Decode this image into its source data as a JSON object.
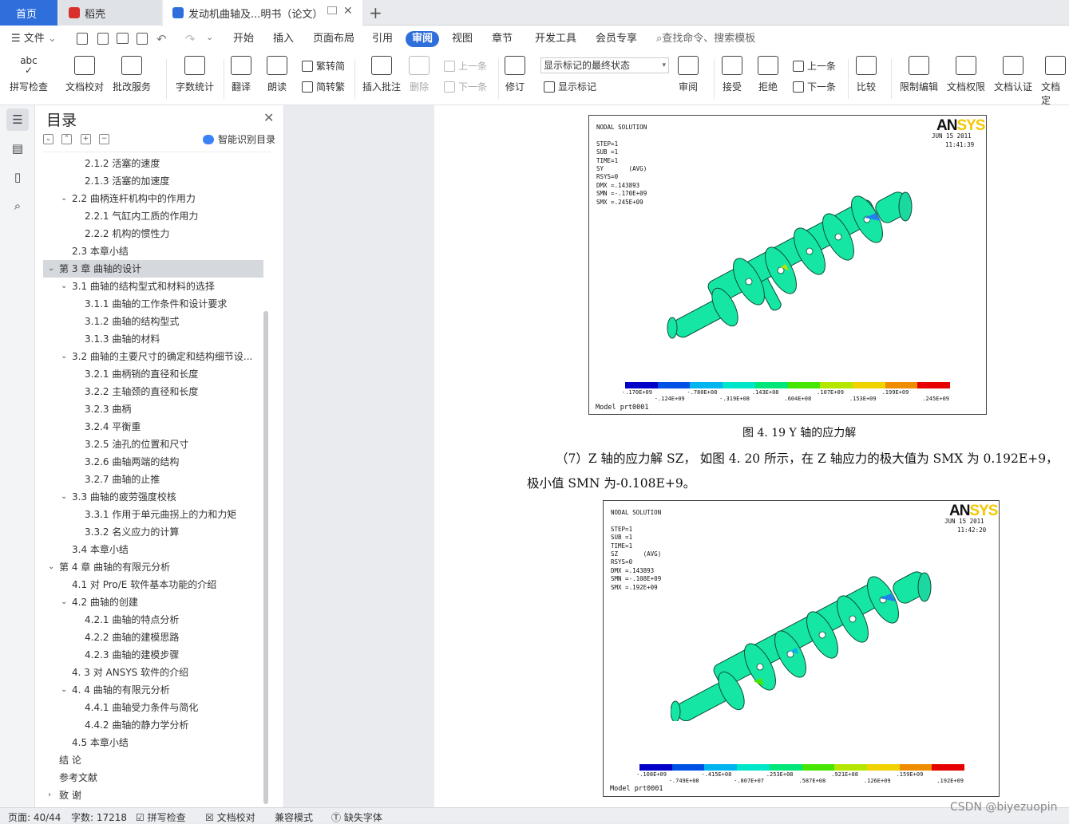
{
  "tabs": {
    "home": "首页",
    "daoke": "稻壳",
    "doc": "发动机曲轴及...明书（论文）",
    "new_tab": "+"
  },
  "menu": {
    "file": "文件",
    "items": [
      "开始",
      "插入",
      "页面布局",
      "引用",
      "审阅",
      "视图",
      "章节",
      "开发工具",
      "会员专享"
    ],
    "active": "审阅",
    "search_placeholder": "查找命令、搜索模板"
  },
  "ribbon": {
    "spell_check": "拼写检查",
    "doc_proof": "文档校对",
    "batch_service": "批改服务",
    "word_count": "字数统计",
    "translate": "翻译",
    "read_aloud": "朗读",
    "trad_to_simp": "繁转简",
    "simp_to_trad": "简转繁",
    "insert_comment": "插入批注",
    "delete": "删除",
    "prev_comment": "上一条",
    "next_comment": "下一条",
    "revise": "修订",
    "markup_select": "显示标记的最终状态",
    "show_markup": "显示标记",
    "review": "审阅",
    "accept": "接受",
    "reject": "拒绝",
    "prev_change": "上一条",
    "next_change": "下一条",
    "compare": "比较",
    "restrict_edit": "限制编辑",
    "doc_permission": "文档权限",
    "doc_cert": "文档认证",
    "doc_more": "文档定"
  },
  "toc": {
    "title": "目录",
    "smart_label": "智能识别目录",
    "items": [
      {
        "text": "2.1.2  活塞的速度",
        "level": 3
      },
      {
        "text": "2.1.3  活塞的加速度",
        "level": 3
      },
      {
        "text": "2.2  曲柄连杆机构中的作用力",
        "level": 2,
        "arrow": "expanded"
      },
      {
        "text": "2.2.1  气缸内工质的作用力",
        "level": 3
      },
      {
        "text": "2.2.2  机构的惯性力",
        "level": 3
      },
      {
        "text": "2.3  本章小结",
        "level": 2
      },
      {
        "text": "第 3 章  曲轴的设计",
        "level": 1,
        "arrow": "expanded",
        "selected": true
      },
      {
        "text": "3.1  曲轴的结构型式和材料的选择",
        "level": 2,
        "arrow": "expanded"
      },
      {
        "text": "3.1.1  曲轴的工作条件和设计要求",
        "level": 3
      },
      {
        "text": "3.1.2  曲轴的结构型式",
        "level": 3
      },
      {
        "text": "3.1.3  曲轴的材料",
        "level": 3
      },
      {
        "text": "3.2  曲轴的主要尺寸的确定和结构细节设...",
        "level": 2,
        "arrow": "expanded"
      },
      {
        "text": "3.2.1  曲柄销的直径和长度",
        "level": 3
      },
      {
        "text": "3.2.2  主轴颈的直径和长度",
        "level": 3
      },
      {
        "text": "3.2.3  曲柄",
        "level": 3
      },
      {
        "text": "3.2.4  平衡重",
        "level": 3
      },
      {
        "text": "3.2.5  油孔的位置和尺寸",
        "level": 3
      },
      {
        "text": "3.2.6  曲轴两端的结构",
        "level": 3
      },
      {
        "text": "3.2.7  曲轴的止推",
        "level": 3
      },
      {
        "text": "3.3  曲轴的疲劳强度校核",
        "level": 2,
        "arrow": "expanded"
      },
      {
        "text": "3.3.1  作用于单元曲拐上的力和力矩",
        "level": 3
      },
      {
        "text": "3.3.2  名义应力的计算",
        "level": 3
      },
      {
        "text": "3.4  本章小结",
        "level": 2
      },
      {
        "text": "第 4 章  曲轴的有限元分析",
        "level": 1,
        "arrow": "expanded"
      },
      {
        "text": "4.1  对 Pro/E 软件基本功能的介绍",
        "level": 2
      },
      {
        "text": "4.2  曲轴的创建",
        "level": 2,
        "arrow": "expanded"
      },
      {
        "text": "4.2.1  曲轴的特点分析",
        "level": 3
      },
      {
        "text": "4.2.2  曲轴的建模思路",
        "level": 3
      },
      {
        "text": "4.2.3  曲轴的建模步骤",
        "level": 3
      },
      {
        "text": "4. 3  对 ANSYS 软件的介绍",
        "level": 2
      },
      {
        "text": "4. 4  曲轴的有限元分析",
        "level": 2,
        "arrow": "expanded"
      },
      {
        "text": "4.4.1  曲轴受力条件与简化",
        "level": 3
      },
      {
        "text": "4.4.2  曲轴的静力学分析",
        "level": 3
      },
      {
        "text": "4.5  本章小结",
        "level": 2
      },
      {
        "text": "结    论",
        "level": 1
      },
      {
        "text": "参考文献",
        "level": 1
      },
      {
        "text": "致    谢",
        "level": 1,
        "arrow": "collapsed"
      }
    ]
  },
  "document": {
    "fig1": {
      "header": "NODAL SOLUTION\n\nSTEP=1\nSUB =1\nTIME=1\nSY       (AVG)\nRSYS=0\nDMX =.143893\nSMN =-.170E+09\nSMX =.245E+09",
      "date": "JUN 15 2011",
      "time": "11:41:39",
      "logo_a": "AN",
      "logo_b": "SYS",
      "labels_top": [
        "-.170E+09",
        "-.780E+08",
        ".143E+08",
        ".107E+09",
        ".199E+09"
      ],
      "labels_bottom": [
        "-.124E+09",
        "-.319E+08",
        ".604E+08",
        ".153E+09",
        ".245E+09"
      ],
      "model": "Model prt0001",
      "caption": "图 4. 19 Y 轴的应力解"
    },
    "para_line1": "（7）Z 轴的应力解 SZ， 如图 4. 20 所示，在 Z 轴应力的极大值为 SMX 为 0.192E+9，",
    "para_line2": "极小值 SMN 为-0.108E+9。",
    "fig2": {
      "header": "NODAL SOLUTION\n\nSTEP=1\nSUB =1\nTIME=1\nSZ       (AVG)\nRSYS=0\nDMX =.143893\nSMN =-.108E+09\nSMX =.192E+09",
      "date": "JUN 15 2011",
      "time": "11:42:20",
      "logo_a": "AN",
      "logo_b": "SYS",
      "labels_top": [
        "-.108E+09",
        "-.415E+08",
        ".253E+08",
        ".921E+08",
        ".159E+09"
      ],
      "labels_bottom": [
        "-.749E+08",
        "-.807E+07",
        ".587E+08",
        ".126E+09",
        ".192E+09"
      ],
      "model": "Model prt0001"
    },
    "colorbar": [
      "#0000c8",
      "#0050e6",
      "#00b4f0",
      "#00e6c8",
      "#00e678",
      "#46e600",
      "#b4e600",
      "#f0d200",
      "#f08c00",
      "#e60000"
    ]
  },
  "status": {
    "page": "页面: 40/44",
    "words": "字数: 17218",
    "spell": "拼写检查",
    "proof": "文档校对",
    "compat": "兼容模式",
    "missing_font": "缺失字体"
  },
  "watermark": "CSDN @biyezuopin"
}
